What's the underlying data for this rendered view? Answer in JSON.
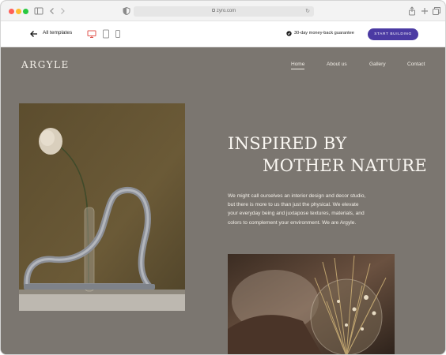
{
  "browser": {
    "url": "zyro.com"
  },
  "toolbar": {
    "back_label": "All templates",
    "guarantee": "30-day money-back guarantee",
    "cta": "START BUILDING"
  },
  "site": {
    "logo": "ARGYLE",
    "nav": [
      {
        "label": "Home",
        "active": true
      },
      {
        "label": "About us",
        "active": false
      },
      {
        "label": "Gallery",
        "active": false
      },
      {
        "label": "Contact",
        "active": false
      }
    ],
    "headline_line1": "INSPIRED BY",
    "headline_line2": "MOTHER NATURE",
    "body_lines": [
      "We might call ourselves an interior design and decor studio,",
      "but there is more to us than just the physical. We elevate",
      "your everyday being and juxtapose textures, materials, and",
      "colors to complement your environment. We are Argyle."
    ]
  },
  "colors": {
    "page_bg": "#7b7670",
    "cta_bg": "#4b3aa3",
    "accent_text": "#fbf8f3"
  }
}
